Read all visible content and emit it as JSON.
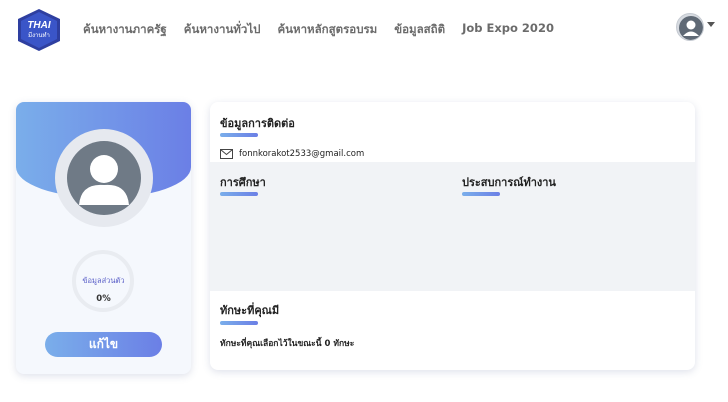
{
  "header": {
    "logo_text": "THAI",
    "logo_subtext": "มีงานทำ",
    "nav": [
      {
        "label": "ค้นหางานภาครัฐ"
      },
      {
        "label": "ค้นหางานทั่วไป"
      },
      {
        "label": "ค้นหาหลักสูตรอบรม"
      },
      {
        "label": "ข้อมูลสถิติ"
      },
      {
        "label": "Job Expo 2020"
      }
    ],
    "user_icon": "user-avatar-icon"
  },
  "profile_card": {
    "profile_icon": "user-silhouette-icon",
    "progress_label": "ข้อมูลส่วนตัว",
    "progress_value": "0%",
    "progress_fraction": 0,
    "edit_label": "แก้ไข"
  },
  "detail_card": {
    "contact_title": "ข้อมูลการติดต่อ",
    "email_icon": "envelope-icon",
    "email": "fonnkorakot2533@gmail.com",
    "education_title": "การศึกษา",
    "experience_title": "ประสบการณ์ทำงาน",
    "skills_title": "ทักษะที่คุณมี",
    "skills_summary": "ทักษะที่คุณเลือกไว้ในขณะนี้ 0 ทักษะ"
  },
  "colors": {
    "accent_start": "#7aaeea",
    "accent_end": "#6b7fe6",
    "logo_bg": "#2e3fa0"
  }
}
